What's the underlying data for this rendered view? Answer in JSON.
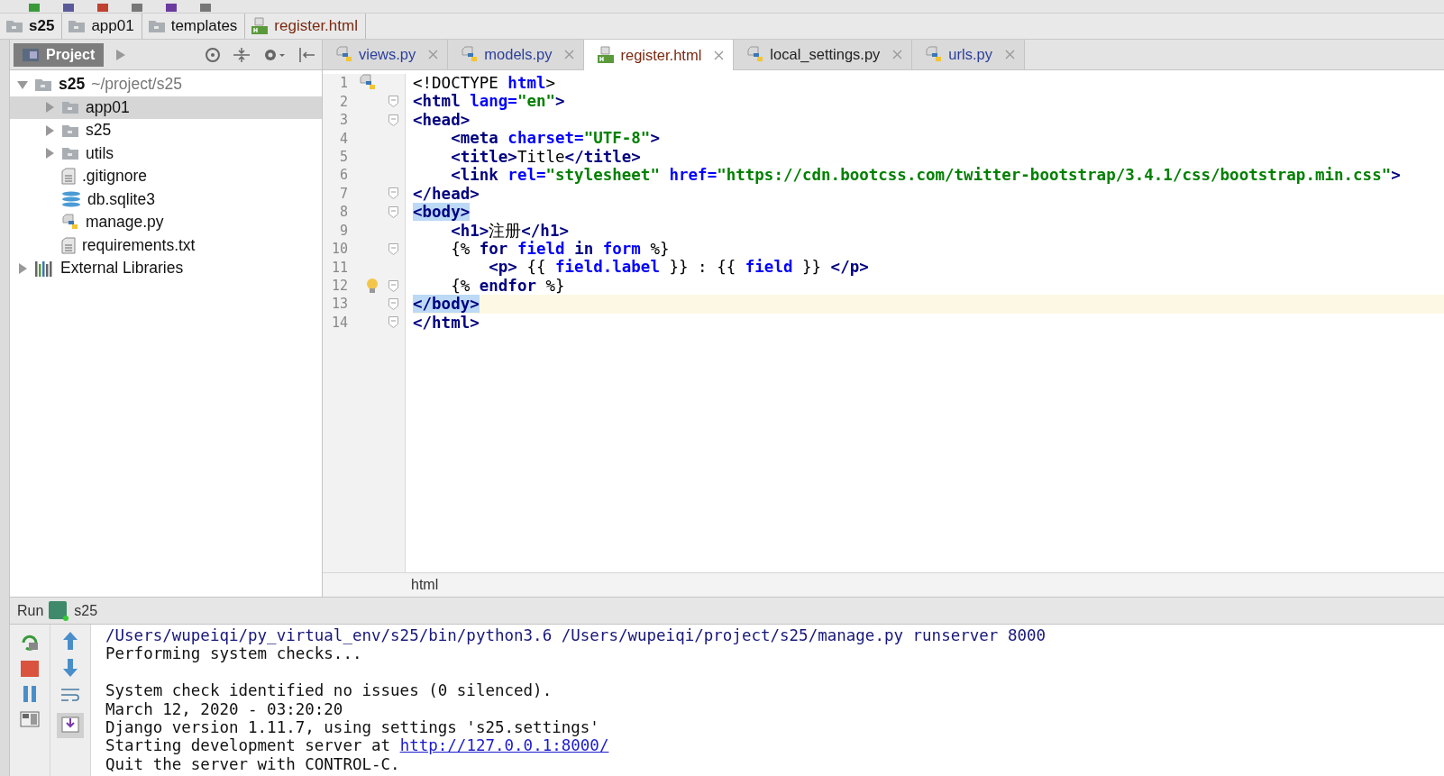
{
  "breadcrumbs": [
    {
      "label": "s25",
      "kind": "root"
    },
    {
      "label": "app01",
      "kind": "folder"
    },
    {
      "label": "templates",
      "kind": "folder"
    },
    {
      "label": "register.html",
      "kind": "html"
    }
  ],
  "project_panel": {
    "title": "Project"
  },
  "editor_tabs": [
    {
      "label": "views.py",
      "kind": "python",
      "color": "#2b3f9c",
      "selected": false
    },
    {
      "label": "models.py",
      "kind": "python",
      "color": "#2b3f9c",
      "selected": false
    },
    {
      "label": "register.html",
      "kind": "html",
      "color": "#7a2a10",
      "selected": true
    },
    {
      "label": "local_settings.py",
      "kind": "python",
      "color": "#222222",
      "selected": false
    },
    {
      "label": "urls.py",
      "kind": "python",
      "color": "#2b3f9c",
      "selected": false
    }
  ],
  "project_tree": [
    {
      "label": "s25",
      "path": "~/project/s25",
      "kind": "folder",
      "expanded": true,
      "selected": false,
      "children": [
        {
          "label": "app01",
          "kind": "folder",
          "expanded": false,
          "selected": true
        },
        {
          "label": "s25",
          "kind": "folder",
          "expanded": false,
          "selected": false
        },
        {
          "label": "utils",
          "kind": "folder",
          "expanded": false,
          "selected": false
        },
        {
          "label": ".gitignore",
          "kind": "file",
          "selected": false
        },
        {
          "label": "db.sqlite3",
          "kind": "database",
          "selected": false
        },
        {
          "label": "manage.py",
          "kind": "python",
          "selected": false
        },
        {
          "label": "requirements.txt",
          "kind": "file",
          "selected": false
        }
      ]
    },
    {
      "label": "External Libraries",
      "kind": "libraries",
      "expanded": false,
      "selected": false
    }
  ],
  "editor": {
    "lines": [
      {
        "number": "1",
        "python_icon": true,
        "fold": false,
        "current": false,
        "tokens": [
          {
            "kind": "text",
            "text": "<!DOCTYPE "
          },
          {
            "kind": "attr",
            "text": "html"
          },
          {
            "kind": "text",
            "text": ">"
          }
        ]
      },
      {
        "number": "2",
        "fold": true,
        "current": false,
        "tokens": [
          {
            "kind": "tag",
            "text": "<html "
          },
          {
            "kind": "attr",
            "text": "lang="
          },
          {
            "kind": "string",
            "text": "\"en\""
          },
          {
            "kind": "tag",
            "text": ">"
          }
        ]
      },
      {
        "number": "3",
        "fold": true,
        "current": false,
        "tokens": [
          {
            "kind": "tag",
            "text": "<head>"
          }
        ]
      },
      {
        "number": "4",
        "fold": false,
        "current": false,
        "tokens": [
          {
            "kind": "tag",
            "text": "    <meta "
          },
          {
            "kind": "attr",
            "text": "charset="
          },
          {
            "kind": "string",
            "text": "\"UTF-8\""
          },
          {
            "kind": "tag",
            "text": ">"
          }
        ]
      },
      {
        "number": "5",
        "fold": false,
        "current": false,
        "tokens": [
          {
            "kind": "tag",
            "text": "    <title>"
          },
          {
            "kind": "text",
            "text": "Title"
          },
          {
            "kind": "tag",
            "text": "</title>"
          }
        ]
      },
      {
        "number": "6",
        "fold": false,
        "current": false,
        "tokens": [
          {
            "kind": "tag",
            "text": "    <link "
          },
          {
            "kind": "attr",
            "text": "rel="
          },
          {
            "kind": "string",
            "text": "\"stylesheet\" "
          },
          {
            "kind": "attr",
            "text": "href="
          },
          {
            "kind": "string",
            "text": "\"https://cdn.bootcss.com/twitter-bootstrap/3.4.1/css/bootstrap.min.css\""
          },
          {
            "kind": "tag",
            "text": ">"
          }
        ]
      },
      {
        "number": "7",
        "fold": true,
        "current": false,
        "tokens": [
          {
            "kind": "tag",
            "text": "</head>"
          }
        ]
      },
      {
        "number": "8",
        "fold": true,
        "current": false,
        "tokens": [
          {
            "kind": "tag",
            "text": "<body>",
            "matched": true
          }
        ]
      },
      {
        "number": "9",
        "fold": false,
        "current": false,
        "tokens": [
          {
            "kind": "tag",
            "text": "    <h1>"
          },
          {
            "kind": "text",
            "text": "注册"
          },
          {
            "kind": "tag",
            "text": "</h1>"
          }
        ]
      },
      {
        "number": "10",
        "fold": true,
        "current": false,
        "tokens": [
          {
            "kind": "text",
            "text": "    {% "
          },
          {
            "kind": "keyword",
            "text": "for "
          },
          {
            "kind": "attr",
            "text": "field "
          },
          {
            "kind": "keyword",
            "text": "in "
          },
          {
            "kind": "attr",
            "text": "form "
          },
          {
            "kind": "text",
            "text": "%}"
          }
        ]
      },
      {
        "number": "11",
        "fold": false,
        "current": false,
        "tokens": [
          {
            "kind": "tag",
            "text": "        <p> "
          },
          {
            "kind": "text",
            "text": "{{ "
          },
          {
            "kind": "attr",
            "text": "field.label "
          },
          {
            "kind": "text",
            "text": "}} : {{ "
          },
          {
            "kind": "attr",
            "text": "field "
          },
          {
            "kind": "text",
            "text": "}} "
          },
          {
            "kind": "tag",
            "text": "</p>"
          }
        ]
      },
      {
        "number": "12",
        "bulb": true,
        "fold": true,
        "current": false,
        "tokens": [
          {
            "kind": "text",
            "text": "    {% "
          },
          {
            "kind": "keyword",
            "text": "endfor "
          },
          {
            "kind": "text",
            "text": "%}"
          }
        ]
      },
      {
        "number": "13",
        "fold": true,
        "current": true,
        "tokens": [
          {
            "kind": "tag",
            "text": "</body>",
            "matched": true
          }
        ]
      },
      {
        "number": "14",
        "fold": true,
        "current": false,
        "tokens": [
          {
            "kind": "tag",
            "text": "</html>"
          }
        ]
      }
    ],
    "breadcrumb": "html"
  },
  "run_panel": {
    "title": "Run",
    "config": "s25",
    "console": [
      {
        "kind": "command",
        "segments": [
          {
            "kind": "text",
            "text": "/Users/wupeiqi/py_virtual_env/s25/bin/python3.6 /Users/wupeiqi/project/s25/manage.py runserver 8000"
          }
        ]
      },
      {
        "kind": "output",
        "segments": [
          {
            "kind": "text",
            "text": "Performing system checks..."
          }
        ]
      },
      {
        "kind": "blank"
      },
      {
        "kind": "output",
        "segments": [
          {
            "kind": "text",
            "text": "System check identified no issues (0 silenced)."
          }
        ]
      },
      {
        "kind": "output",
        "segments": [
          {
            "kind": "text",
            "text": "March 12, 2020 - 03:20:20"
          }
        ]
      },
      {
        "kind": "output",
        "segments": [
          {
            "kind": "text",
            "text": "Django version 1.11.7, using settings 's25.settings'"
          }
        ]
      },
      {
        "kind": "output",
        "segments": [
          {
            "kind": "text",
            "text": "Starting development server at "
          },
          {
            "kind": "link",
            "text": "http://127.0.0.1:8000/"
          }
        ]
      },
      {
        "kind": "output",
        "segments": [
          {
            "kind": "text",
            "text": "Quit the server with CONTROL-C."
          }
        ]
      }
    ]
  }
}
